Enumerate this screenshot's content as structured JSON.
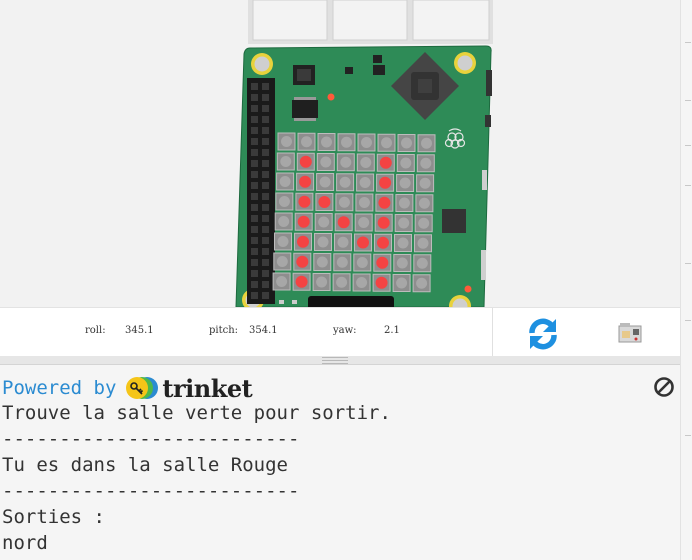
{
  "sensors": {
    "roll_label": "roll:",
    "roll_value": "345.1",
    "pitch_label": "pitch:",
    "pitch_value": "354.1",
    "yaw_label": "yaw:",
    "yaw_value": "2.1"
  },
  "icons": {
    "refresh": "refresh-icon",
    "raspberry_pi": "raspberry-pi-icon",
    "clear": "clear-console-icon",
    "trinket": "trinket-logo-icon"
  },
  "console": {
    "powered_by": "Powered by",
    "brand": "trinket",
    "lines": [
      "Trouve la salle verte pour sortir.",
      "--------------------------",
      "Tu es dans la salle Rouge",
      "--------------------------",
      "Sorties :",
      "nord"
    ]
  },
  "led_matrix": {
    "on_color": "#ff3b3b",
    "off_color": "#9a9a9a",
    "rows": [
      "........",
      ".X...X..",
      ".X...X..",
      ".XX..X..",
      ".X.X.X..",
      ".X..XX..",
      ".X...X..",
      ".X...X.."
    ]
  },
  "colors": {
    "board_green": "#2e8b57",
    "link_blue": "#2b8bd1",
    "refresh_blue": "#1e90e0"
  }
}
